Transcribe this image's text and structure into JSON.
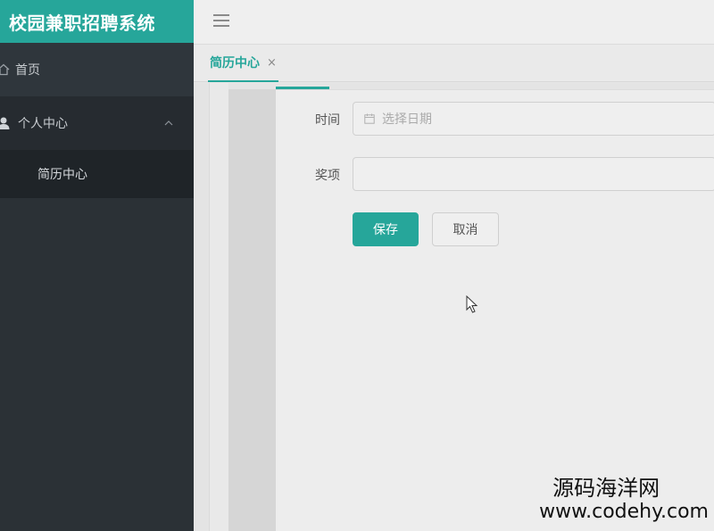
{
  "app": {
    "title": "校园兼职招聘系统"
  },
  "sidebar": {
    "items": [
      {
        "label": "首页",
        "icon": "home-icon"
      },
      {
        "label": "个人中心",
        "icon": "user-icon",
        "expanded": true,
        "children": [
          {
            "label": "简历中心"
          }
        ]
      }
    ]
  },
  "tabs": [
    {
      "label": "简历中心",
      "close": "×",
      "active": true
    }
  ],
  "form": {
    "time": {
      "label": "时间",
      "placeholder": "选择日期",
      "icon": "calendar-icon"
    },
    "award": {
      "label": "奖项",
      "value": ""
    },
    "save_label": "保存",
    "cancel_label": "取消"
  },
  "watermark": {
    "line1": "源码海洋网",
    "line2": "www.codehy.com"
  },
  "colors": {
    "accent": "#26a69a",
    "sidebar_bg": "#2b3136"
  }
}
